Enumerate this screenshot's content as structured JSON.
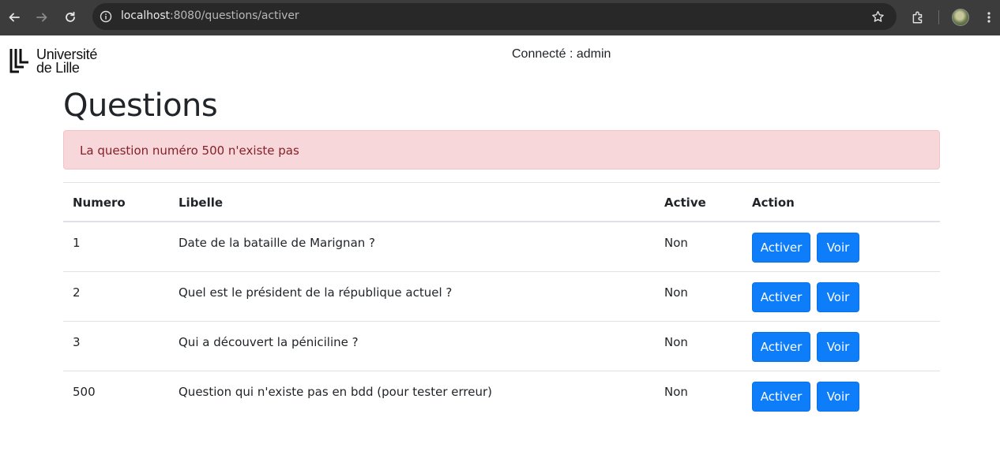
{
  "browser": {
    "url_host": "localhost",
    "url_rest": ":8080/questions/activer"
  },
  "header": {
    "logo_line1": "Université",
    "logo_line2": "de Lille",
    "connected": "Connecté : admin"
  },
  "page": {
    "title": "Questions",
    "alert": "La question numéro 500 n'existe pas"
  },
  "table": {
    "headers": {
      "numero": "Numero",
      "libelle": "Libelle",
      "active": "Active",
      "action": "Action"
    },
    "rows": [
      {
        "numero": "1",
        "libelle": "Date de la bataille de Marignan ?",
        "active": "Non",
        "activer": "Activer",
        "voir": "Voir"
      },
      {
        "numero": "2",
        "libelle": "Quel est le président de la république actuel ?",
        "active": "Non",
        "activer": "Activer",
        "voir": "Voir"
      },
      {
        "numero": "3",
        "libelle": "Qui a découvert la péniciline ?",
        "active": "Non",
        "activer": "Activer",
        "voir": "Voir"
      },
      {
        "numero": "500",
        "libelle": "Question qui n'existe pas en bdd (pour tester erreur)",
        "active": "Non",
        "activer": "Activer",
        "voir": "Voir"
      }
    ]
  },
  "colors": {
    "primary": "#0d7dfa",
    "alert_bg": "#f8d7da",
    "alert_text": "#842029"
  }
}
